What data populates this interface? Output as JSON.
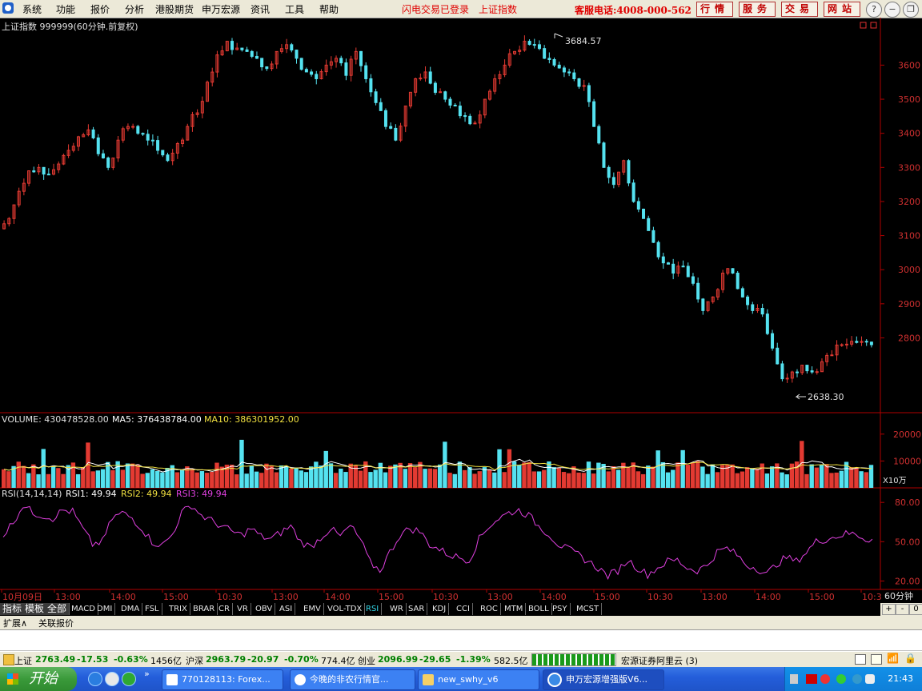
{
  "menubar": {
    "items": [
      "系统",
      "功能",
      "报价",
      "分析",
      "港股期货",
      "申万宏源",
      "资讯",
      "工具",
      "帮助"
    ],
    "flash_login": "闪电交易已登录",
    "current_index": "上证指数",
    "hotline": "客服电话:4008-000-562",
    "buttons": [
      "行情",
      "服务",
      "交易",
      "网站"
    ],
    "window_buttons": [
      "?",
      "−",
      "❐",
      "✕"
    ]
  },
  "kline": {
    "title": "上证指数 999999(60分钟.前复权)",
    "high_label": "3684.57",
    "low_label": "2638.30",
    "y_ticks": [
      3600,
      3500,
      3400,
      3300,
      3200,
      3100,
      3000,
      2900,
      2800
    ],
    "ylim": [
      2590,
      3730
    ],
    "colors": {
      "up": "#e33a32",
      "down": "#55e2f0",
      "axis": "#b00000",
      "tick_text": "#d03030"
    }
  },
  "volume": {
    "label": "VOLUME: 430478528.00",
    "ma5_label": "MA5: 376438784.00",
    "ma10_label": "MA10: 386301952.00",
    "y_ticks": [
      "20000",
      "10000"
    ],
    "unit": "X10万",
    "colors": {
      "ma5": "#ffffff",
      "ma10": "#f0e040"
    }
  },
  "rsi": {
    "params": "RSI(14,14,14)",
    "rsi1": "RSI1: 49.94",
    "rsi2": "RSI2: 49.94",
    "rsi3": "RSI3: 49.94",
    "y_ticks": [
      "80.00",
      "50.00",
      "20.00"
    ],
    "colors": {
      "rsi1": "#ffffff",
      "rsi2": "#f0e040",
      "rsi3": "#e040e0"
    }
  },
  "time_axis": {
    "labels": [
      "10月09日",
      "13:00",
      "14:00",
      "15:00",
      "10:30",
      "13:00",
      "14:00",
      "15:00",
      "10:30",
      "13:00",
      "14:00",
      "15:00",
      "10:30",
      "13:00",
      "14:00",
      "15:00",
      "10:3"
    ],
    "period": "60分钟"
  },
  "chart_data": [
    {
      "type": "candlestick",
      "title": "上证指数 999999(60分钟.前复权)",
      "y_ticks": [
        2800,
        2900,
        3000,
        3100,
        3200,
        3300,
        3400,
        3500,
        3600
      ],
      "high": 3684.57,
      "low": 2638.3,
      "close_series": [
        3150,
        3230,
        3290,
        3300,
        3280,
        3310,
        3350,
        3390,
        3410,
        3340,
        3300,
        3380,
        3420,
        3400,
        3380,
        3350,
        3320,
        3370,
        3420,
        3460,
        3550,
        3630,
        3670,
        3650,
        3640,
        3620,
        3590,
        3640,
        3660,
        3620,
        3580,
        3560,
        3600,
        3620,
        3570,
        3640,
        3560,
        3490,
        3420,
        3380,
        3480,
        3560,
        3580,
        3520,
        3500,
        3480,
        3450,
        3430,
        3500,
        3560,
        3600,
        3640,
        3670,
        3660,
        3620,
        3600,
        3580,
        3560,
        3540,
        3420,
        3300,
        3250,
        3320,
        3200,
        3150,
        3080,
        3020,
        2990,
        3010,
        2960,
        2880,
        2920,
        2990,
        2990,
        2920,
        2880,
        2870,
        2770,
        2680,
        2700,
        2720,
        2700,
        2730,
        2750,
        2780,
        2790,
        2790,
        2780
      ]
    },
    {
      "type": "bar",
      "title": "VOLUME",
      "ylim": [
        0,
        25000
      ],
      "unit": "X10万"
    },
    {
      "type": "line",
      "title": "RSI(14,14,14)",
      "ylim": [
        20,
        80
      ],
      "series": [
        {
          "name": "RSI1",
          "values": [
            55,
            65,
            78,
            72,
            70,
            68,
            74,
            73,
            60,
            48,
            50,
            68,
            72,
            68,
            60,
            50,
            47,
            55,
            72,
            78,
            70,
            66,
            62,
            58,
            55,
            60,
            54,
            52,
            57,
            62,
            50,
            46,
            53,
            60,
            54,
            62,
            52,
            34,
            28,
            42,
            55,
            60,
            58,
            48,
            44,
            40,
            38,
            36,
            52,
            62,
            68,
            72,
            74,
            70,
            62,
            56,
            48,
            44,
            40,
            35,
            30,
            24,
            28,
            36,
            30,
            25,
            30,
            35,
            36,
            30,
            28,
            32,
            42,
            45,
            40,
            32,
            30,
            25,
            33,
            38,
            35,
            42,
            50,
            52,
            54,
            56,
            56,
            52
          ]
        }
      ]
    }
  ],
  "indicator_tabs": [
    "指标",
    "模板",
    "全部",
    "MACD",
    "DMI",
    "DMA",
    "FSL",
    "TRIX",
    "BRAR",
    "CR",
    "VR",
    "OBV",
    "ASI",
    "EMV",
    "VOL-TDX",
    "RSI",
    "WR",
    "SAR",
    "KDJ",
    "CCI",
    "ROC",
    "MTM",
    "BOLL",
    "PSY",
    "MCST"
  ],
  "right_controls": [
    "+",
    "-",
    "0"
  ],
  "ext_tabs": [
    "扩展∧",
    "关联报价"
  ],
  "statusbar": {
    "sh": {
      "name": "上证",
      "value": "2763.49",
      "change": "-17.53",
      "pct": "-0.63%",
      "amount": "1456亿"
    },
    "hs": {
      "name": "沪深",
      "value": "2963.79",
      "change": "-20.97",
      "pct": "-0.70%",
      "amount": "774.4亿"
    },
    "cy": {
      "name": "创业",
      "value": "2096.99",
      "change": "-29.65",
      "pct": "-1.39%",
      "amount": "582.5亿"
    },
    "server": "宏源证券阿里云 (3)"
  },
  "taskbar": {
    "start": "开始",
    "tasks": [
      "770128113: Forex...",
      "今晚的非农行情官...",
      "new_swhy_v6",
      "申万宏源增强版V6..."
    ],
    "clock": "21:43"
  }
}
